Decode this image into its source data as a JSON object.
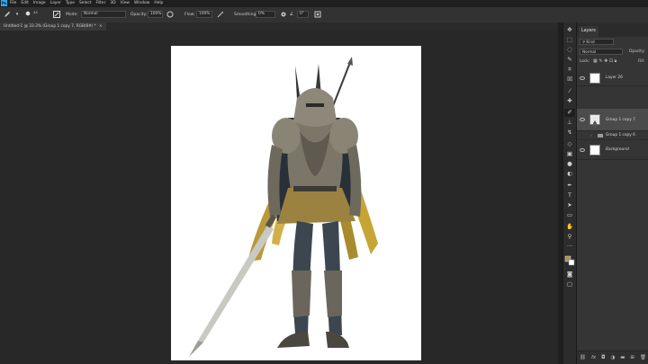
{
  "menubar": {
    "logo": "Ps",
    "items": [
      "File",
      "Edit",
      "Image",
      "Layer",
      "Type",
      "Select",
      "Filter",
      "3D",
      "View",
      "Window",
      "Help"
    ]
  },
  "options": {
    "brush_size": "44",
    "mode_label": "Mode:",
    "mode_value": "Normal",
    "opacity_label": "Opacity:",
    "opacity_value": "100%",
    "flow_label": "Flow:",
    "flow_value": "100%",
    "smoothing_label": "Smoothing:",
    "smoothing_value": "0%",
    "angle_value": "0°"
  },
  "document": {
    "tab_title": "Untitled-1 @ 33.3% (Group 1 copy 7, RGB/8#) *",
    "close_glyph": "×"
  },
  "layers_panel": {
    "tab_label": "Layers",
    "filter_kind": "Kind",
    "blend_mode": "Normal",
    "opacity_label": "Opacity:",
    "lock_label": "Lock:",
    "fill_label": "Fill:",
    "layers": [
      {
        "name": "Layer 26",
        "type": "layer",
        "selected": false
      },
      {
        "name": "Group 1 copy 7",
        "type": "layer",
        "selected": true
      },
      {
        "name": "Group 1 copy 6",
        "type": "group",
        "selected": false
      },
      {
        "name": "Background",
        "type": "background",
        "selected": false
      }
    ],
    "footer_icons": [
      "link-icon",
      "fx-icon",
      "mask-icon",
      "adjustment-icon",
      "folder-icon",
      "new-layer-icon",
      "trash-icon"
    ]
  },
  "tools": [
    "move-icon",
    "marquee-icon",
    "lasso-icon",
    "quick-select-icon",
    "crop-icon",
    "frame-icon",
    "eyedropper-icon",
    "healing-icon",
    "brush-icon",
    "stamp-icon",
    "history-brush-icon",
    "eraser-icon",
    "gradient-icon",
    "blur-icon",
    "dodge-icon",
    "pen-icon",
    "type-icon",
    "path-select-icon",
    "rectangle-icon",
    "hand-icon",
    "zoom-icon",
    "more-icon",
    "color-swatches",
    "quick-mask-icon",
    "screen-mode-icon"
  ],
  "colors": {
    "accent": "#31a8ff",
    "panel": "#353535",
    "canvas_bg": "#282828"
  }
}
